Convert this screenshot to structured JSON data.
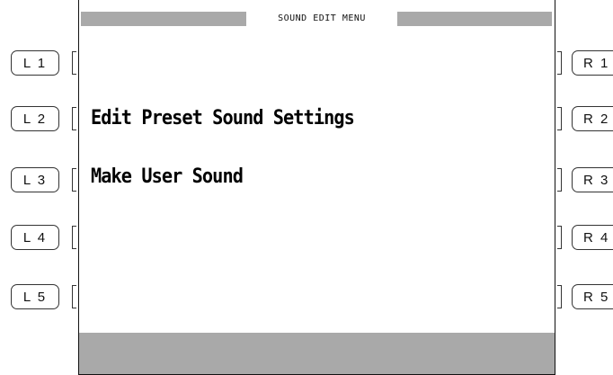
{
  "screen": {
    "title": "SOUND EDIT MENU",
    "menu": [
      {
        "slot": "L2",
        "label": "Edit Preset Sound Settings"
      },
      {
        "slot": "L3",
        "label": "Make User Sound"
      }
    ]
  },
  "buttons": {
    "left": [
      "L 1",
      "L 2",
      "L 3",
      "L 4",
      "L 5"
    ],
    "right": [
      "R 1",
      "R 2",
      "R 3",
      "R 4",
      "R 5"
    ]
  }
}
